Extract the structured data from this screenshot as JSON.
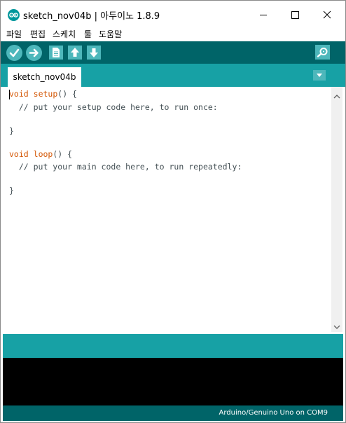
{
  "window": {
    "title": "sketch_nov04b | 아두이노 1.8.9"
  },
  "menu": {
    "items": [
      "파일",
      "편집",
      "스케치",
      "툴",
      "도움말"
    ]
  },
  "toolbar": {
    "buttons": [
      {
        "name": "verify",
        "icon": "checkmark-icon"
      },
      {
        "name": "upload",
        "icon": "right-arrow-icon"
      },
      {
        "name": "new",
        "icon": "new-file-icon"
      },
      {
        "name": "open",
        "icon": "up-arrow-icon"
      },
      {
        "name": "save",
        "icon": "down-arrow-icon"
      },
      {
        "name": "serial-monitor",
        "icon": "magnifier-icon"
      }
    ]
  },
  "tabs": [
    {
      "label": "sketch_nov04b"
    }
  ],
  "editor": {
    "lines": [
      {
        "kw": "void",
        "fn": "setup",
        "rest": "() {"
      },
      {
        "comment": "  // put your setup code here, to run once:"
      },
      {
        "text": ""
      },
      {
        "text": "}"
      },
      {
        "text": ""
      },
      {
        "kw": "void",
        "fn": "loop",
        "rest": "() {"
      },
      {
        "comment": "  // put your main code here, to run repeatedly:"
      },
      {
        "text": ""
      },
      {
        "text": "}"
      }
    ]
  },
  "status": {
    "board": "Arduino/Genuino Uno on COM9"
  },
  "colors": {
    "toolbar": "#006468",
    "accent": "#17a1a5",
    "button": "#4db7bb",
    "keyword": "#d35400",
    "console": "#000000"
  }
}
